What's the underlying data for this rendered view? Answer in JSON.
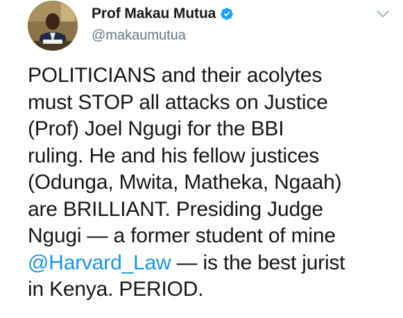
{
  "tweet": {
    "author": {
      "display_name": "Prof Makau Mutua",
      "handle": "@makaumutua",
      "verified": true,
      "verified_icon": "verified-badge-icon",
      "avatar_icon": "profile-photo"
    },
    "menu_icon": "chevron-down-icon",
    "text_lines": [
      {
        "text": "POLITICIANS and their acolytes"
      },
      {
        "text": "must STOP all attacks on Justice"
      },
      {
        "text": "(Prof) Joel Ngugi for the BBI"
      },
      {
        "text": "ruling.  He and his fellow justices"
      },
      {
        "text": "(Odunga, Mwita, Matheka, Ngaah)"
      },
      {
        "text": "are BRILLIANT.  Presiding Judge"
      },
      {
        "text": "Ngugi — a former student of mine"
      },
      {
        "mention": "@Harvard_Law",
        "after": " — is the best jurist"
      },
      {
        "text": "in Kenya.  PERIOD."
      }
    ]
  },
  "colors": {
    "text": "#14171a",
    "secondary": "#657786",
    "link": "#1b95e0",
    "verified": "#1da1f2"
  }
}
